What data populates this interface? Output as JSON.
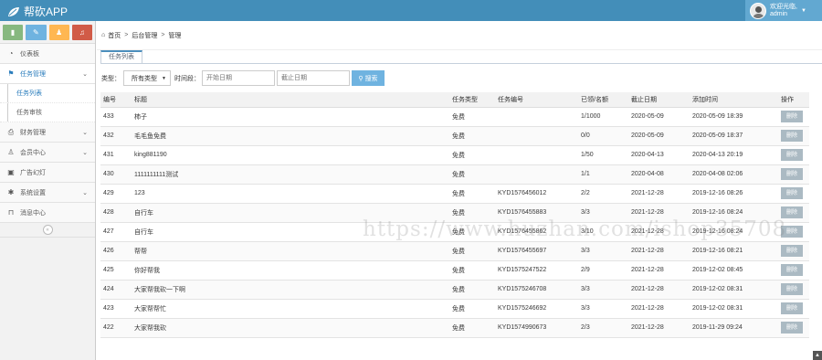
{
  "app": {
    "title": "帮砍APP"
  },
  "user": {
    "greeting": "欢迎光临,",
    "name": "admin"
  },
  "shortcuts": [
    {
      "icon": "chart-icon",
      "glyph": "▮",
      "color": "#87b87f"
    },
    {
      "icon": "pencil-icon",
      "glyph": "✎",
      "color": "#6fb3e0"
    },
    {
      "icon": "users-icon",
      "glyph": "♟",
      "color": "#ffb752"
    },
    {
      "icon": "bell-icon",
      "glyph": "♫",
      "color": "#d15b47"
    }
  ],
  "sidebar": {
    "items": [
      {
        "label": "仪表板",
        "icon": "dashboard-icon"
      },
      {
        "label": "任务管理",
        "icon": "flag-icon",
        "active": true,
        "sub": [
          {
            "label": "任务列表",
            "active": true
          },
          {
            "label": "任务审核"
          }
        ]
      },
      {
        "label": "财务管理",
        "icon": "print-icon"
      },
      {
        "label": "会员中心",
        "icon": "user-icon"
      },
      {
        "label": "广告幻灯",
        "icon": "picture-icon"
      },
      {
        "label": "系统设置",
        "icon": "cog-icon"
      },
      {
        "label": "消息中心",
        "icon": "bookmark-icon"
      }
    ]
  },
  "breadcrumb": {
    "home": "首页",
    "level2": "后台管理",
    "level3": "管理"
  },
  "tabs": [
    {
      "label": "任务列表"
    }
  ],
  "filter": {
    "type_label": "类型：",
    "type_value": "所有类型",
    "time_label": "时间段：",
    "start_placeholder": "开始日期",
    "end_placeholder": "截止日期",
    "search_label": "搜索"
  },
  "table": {
    "columns": [
      "编号",
      "标题",
      "任务类型",
      "任务编号",
      "已领/名额",
      "截止日期",
      "添加时间",
      "操作"
    ],
    "delete_label": "删除",
    "rows": [
      [
        "433",
        "柿子",
        "免费",
        "",
        "1/1000",
        "2020-05-09",
        "2020-05-09 18:39"
      ],
      [
        "432",
        "毛毛鱼免费",
        "免费",
        "",
        "0/0",
        "2020-05-09",
        "2020-05-09 18:37"
      ],
      [
        "431",
        "king881190",
        "免费",
        "",
        "1/50",
        "2020-04-13",
        "2020-04-13 20:19"
      ],
      [
        "430",
        "1111111111测试",
        "免费",
        "",
        "1/1",
        "2020-04-08",
        "2020-04-08 02:06"
      ],
      [
        "429",
        "123",
        "免费",
        "KYD1576456012",
        "2/2",
        "2021-12-28",
        "2019-12-16 08:26"
      ],
      [
        "428",
        "自行车",
        "免费",
        "KYD1576455883",
        "3/3",
        "2021-12-28",
        "2019-12-16 08:24"
      ],
      [
        "427",
        "自行车",
        "免费",
        "KYD1576455862",
        "3/10",
        "2021-12-28",
        "2019-12-16 08:24"
      ],
      [
        "426",
        "帮帮",
        "免费",
        "KYD1576455697",
        "3/3",
        "2021-12-28",
        "2019-12-16 08:21"
      ],
      [
        "425",
        "你好帮我",
        "免费",
        "KYD1575247522",
        "2/9",
        "2021-12-28",
        "2019-12-02 08:45"
      ],
      [
        "424",
        "大家帮我砍一下啊",
        "免费",
        "KYD1575246708",
        "3/3",
        "2021-12-28",
        "2019-12-02 08:31"
      ],
      [
        "423",
        "大家帮帮忙",
        "免费",
        "KYD1575246692",
        "3/3",
        "2021-12-28",
        "2019-12-02 08:31"
      ],
      [
        "422",
        "大家帮我砍",
        "免费",
        "KYD1574990673",
        "2/3",
        "2021-12-28",
        "2019-11-29 09:24"
      ]
    ]
  },
  "watermark": "https://www.huzhan.com/ishop35708"
}
